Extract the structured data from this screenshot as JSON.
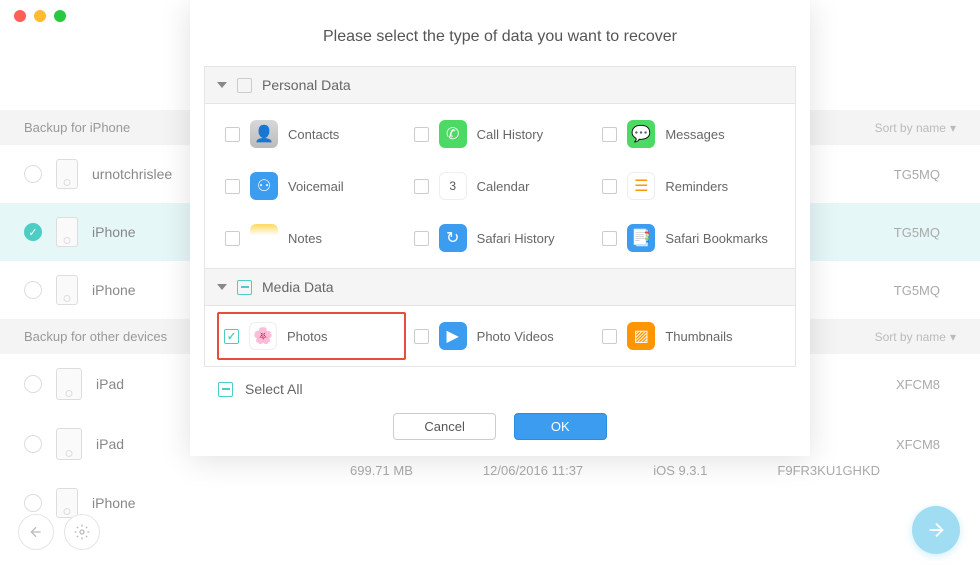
{
  "header": {
    "backup_iphone": "Backup for iPhone",
    "backup_other": "Backup for other devices",
    "sort_by": "Sort by name"
  },
  "devices": {
    "iphone1": {
      "name": "urnotchrislee",
      "serial": "TG5MQ"
    },
    "iphone2": {
      "name": "iPhone",
      "serial": "TG5MQ"
    },
    "iphone3": {
      "name": "iPhone",
      "serial": "TG5MQ"
    },
    "ipad1": {
      "name": "iPad",
      "serial": "XFCM8"
    },
    "ipad2": {
      "name": "iPad",
      "serial": "XFCM8"
    },
    "iphone4": {
      "name": "iPhone",
      "info": {
        "size": "699.71 MB",
        "date": "12/06/2016 11:37",
        "ios": "iOS 9.3.1",
        "serial": "F9FR3KU1GHKD"
      }
    }
  },
  "modal": {
    "title": "Please select the type of data you want to recover",
    "cat_personal": "Personal Data",
    "cat_media": "Media Data",
    "items": {
      "contacts": "Contacts",
      "call_history": "Call History",
      "messages": "Messages",
      "voicemail": "Voicemail",
      "calendar": "Calendar",
      "reminders": "Reminders",
      "notes": "Notes",
      "safari_history": "Safari History",
      "safari_bookmarks": "Safari Bookmarks",
      "photos": "Photos",
      "photo_videos": "Photo Videos",
      "thumbnails": "Thumbnails"
    },
    "select_all": "Select All",
    "cancel": "Cancel",
    "ok": "OK"
  }
}
